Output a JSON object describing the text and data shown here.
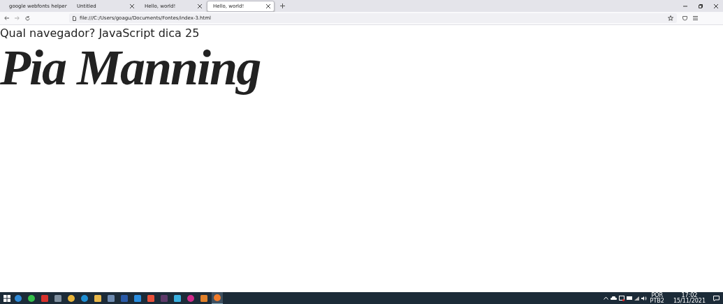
{
  "tabs": [
    {
      "label": "google webfonts helper",
      "selected": false
    },
    {
      "label": "Untitled",
      "selected": false
    },
    {
      "label": "Hello, world!",
      "selected": false
    },
    {
      "label": "Hello, world!",
      "selected": true
    }
  ],
  "address_bar": {
    "url": "file:///C:/Users/goagu/Documents/Fontes/index-3.html"
  },
  "page": {
    "heading": "Qual navegador? JavaScript dica 25",
    "script_title": "Pia Manning"
  },
  "taskbar": {
    "apps": [
      {
        "kind": "circle",
        "color": "#2f8ad8",
        "selected": false
      },
      {
        "kind": "circle",
        "color": "#35c04a",
        "selected": false
      },
      {
        "kind": "square",
        "color": "#d8322c",
        "selected": false
      },
      {
        "kind": "square",
        "color": "#7f8f9f",
        "selected": false
      },
      {
        "kind": "circle",
        "color": "#e8b43a",
        "selected": false
      },
      {
        "kind": "circle",
        "color": "#1f8fd4",
        "selected": false
      },
      {
        "kind": "square",
        "color": "#e9b84a",
        "selected": false
      },
      {
        "kind": "square",
        "color": "#6d8ab0",
        "selected": false
      },
      {
        "kind": "square",
        "color": "#2a5aa8",
        "selected": false
      },
      {
        "kind": "square",
        "color": "#2a8ee0",
        "selected": false
      },
      {
        "kind": "square",
        "color": "#e8503a",
        "selected": false
      },
      {
        "kind": "square",
        "color": "#5e3a6a",
        "selected": false
      },
      {
        "kind": "square",
        "color": "#3ab0e0",
        "selected": false
      },
      {
        "kind": "circle",
        "color": "#d02a8a",
        "selected": false
      },
      {
        "kind": "square",
        "color": "#e0802a",
        "selected": false
      },
      {
        "kind": "circle",
        "color": "#f07a2a",
        "selected": true
      }
    ],
    "language": "POR",
    "layout": "PTB2",
    "time": "17:02",
    "date": "15/11/2021"
  }
}
